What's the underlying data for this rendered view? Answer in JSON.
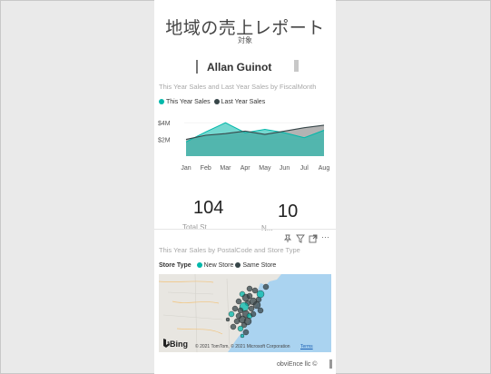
{
  "report": {
    "title": "地域の売上レポート",
    "subtitle": "対象"
  },
  "filter": {
    "name": "Allan Guinot"
  },
  "line_chart": {
    "title": "This Year Sales and Last Year Sales by FiscalMonth",
    "legend": [
      {
        "label": "This Year Sales",
        "color": "#01b8aa"
      },
      {
        "label": "Last Year Sales",
        "color": "#374649"
      }
    ]
  },
  "chart_data": {
    "type": "area",
    "title": "This Year Sales and Last Year Sales by FiscalMonth",
    "categories": [
      "Jan",
      "Feb",
      "Mar",
      "Apr",
      "May",
      "Jun",
      "Jul",
      "Aug"
    ],
    "y_ticks": [
      "$4M",
      "$2M"
    ],
    "ylim": [
      0,
      5
    ],
    "series": [
      {
        "name": "This Year Sales",
        "values": [
          1.7,
          2.9,
          4.0,
          2.8,
          3.2,
          2.8,
          2.2,
          3.1
        ],
        "color": "#01b8aa"
      },
      {
        "name": "Last Year Sales",
        "values": [
          2.0,
          2.5,
          2.7,
          3.0,
          2.6,
          3.0,
          3.4,
          3.7
        ],
        "color": "#374649"
      }
    ]
  },
  "kpis": [
    {
      "value": "104",
      "label_fragment": "Total St..."
    },
    {
      "value": "10",
      "label_fragment": "N..."
    }
  ],
  "visual_toolbar": {
    "icons": [
      "pin-icon",
      "filter-icon",
      "focus-mode-icon",
      "more-options-icon"
    ],
    "more": "···"
  },
  "map_visual": {
    "title": "This Year Sales by PostalCode and Store Type",
    "legend_title": "Store Type",
    "legend": [
      {
        "label": "New Store",
        "color": "#01b8aa"
      },
      {
        "label": "Same Store",
        "color": "#374649"
      }
    ],
    "attribution": "© 2021 TomTom, © 2021 Microsoft Corporation",
    "terms": "Terms",
    "bing": "Bing"
  },
  "footer": {
    "text": "obviEnce llc ©"
  }
}
